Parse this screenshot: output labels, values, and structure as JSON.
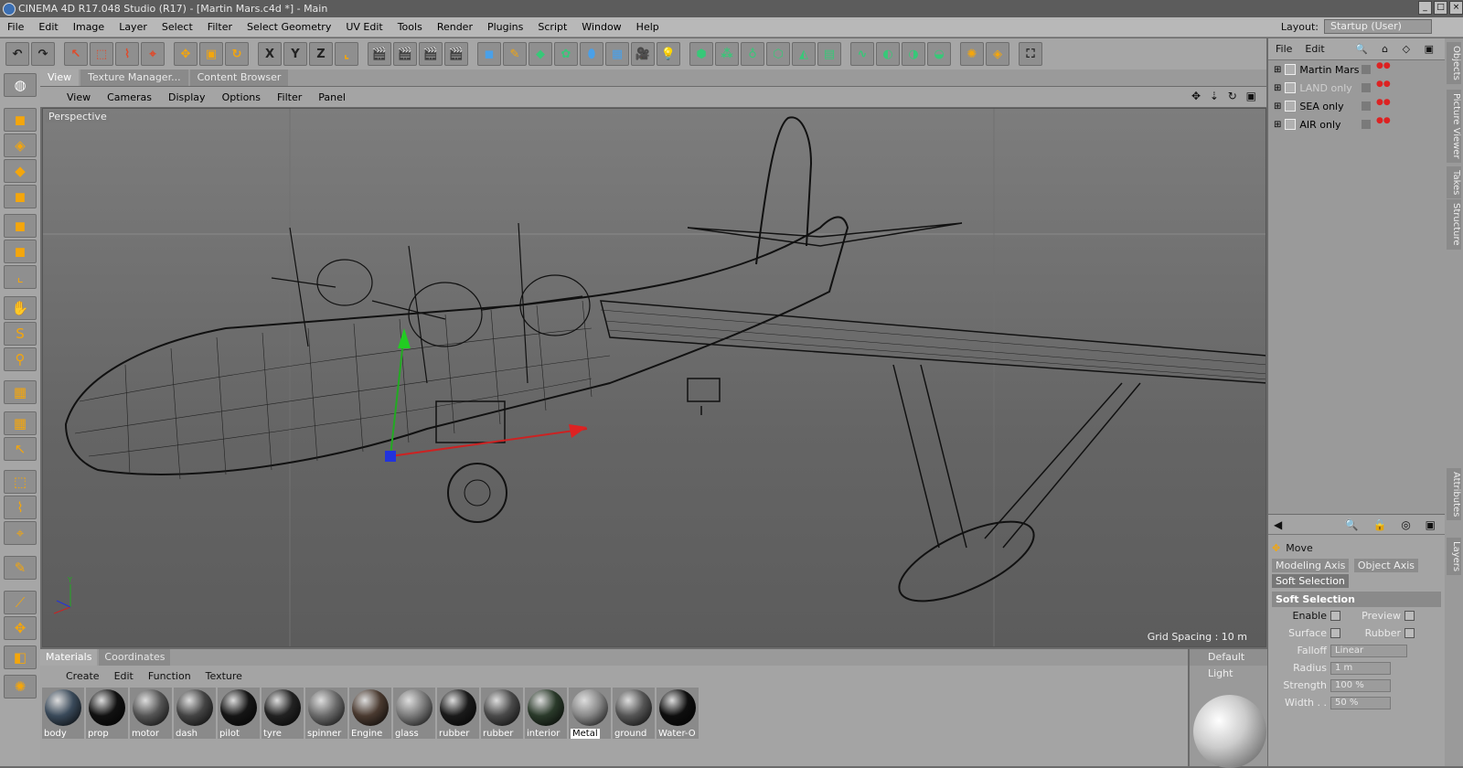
{
  "window": {
    "title": "CINEMA 4D R17.048 Studio (R17) - [Martin Mars.c4d *] - Main"
  },
  "menu": [
    "File",
    "Edit",
    "Image",
    "Layer",
    "Select",
    "Filter",
    "Select Geometry",
    "UV Edit",
    "Tools",
    "Render",
    "Plugins",
    "Script",
    "Window",
    "Help"
  ],
  "layout": {
    "label": "Layout:",
    "value": "Startup (User)"
  },
  "toolbar": [
    {
      "icon": "undo-icon",
      "glyph": "↶",
      "c": "k"
    },
    {
      "icon": "redo-icon",
      "glyph": "↷",
      "c": "k"
    },
    {
      "icon": "live-selection-icon",
      "glyph": "↖",
      "c": "r"
    },
    {
      "icon": "rectangle-selection-icon",
      "glyph": "⬚",
      "c": "r"
    },
    {
      "icon": "lasso-selection-icon",
      "glyph": "⌇",
      "c": "r"
    },
    {
      "icon": "polygon-selection-icon",
      "glyph": "⌖",
      "c": "r"
    },
    {
      "icon": "move-icon",
      "glyph": "✥",
      "c": "o"
    },
    {
      "icon": "scale-icon",
      "glyph": "▣",
      "c": "o"
    },
    {
      "icon": "rotate-icon",
      "glyph": "↻",
      "c": "o"
    },
    {
      "icon": "x-axis-icon",
      "glyph": "X",
      "c": "k"
    },
    {
      "icon": "y-axis-icon",
      "glyph": "Y",
      "c": "k"
    },
    {
      "icon": "z-axis-icon",
      "glyph": "Z",
      "c": "k"
    },
    {
      "icon": "coordinate-system-icon",
      "glyph": "⌞",
      "c": "o"
    },
    {
      "icon": "render-view-icon",
      "glyph": "🎬",
      "c": "k"
    },
    {
      "icon": "render-picture-viewer-icon",
      "glyph": "🎬",
      "c": "k"
    },
    {
      "icon": "render-settings-icon",
      "glyph": "🎬",
      "c": "k"
    },
    {
      "icon": "edit-render-settings-icon",
      "glyph": "🎬",
      "c": "k"
    },
    {
      "icon": "cube-icon",
      "glyph": "◼",
      "c": "b"
    },
    {
      "icon": "pen-icon",
      "glyph": "✎",
      "c": "o"
    },
    {
      "icon": "subdivision-icon",
      "glyph": "◆",
      "c": "g"
    },
    {
      "icon": "cloner-icon",
      "glyph": "✿",
      "c": "g"
    },
    {
      "icon": "deformer-icon",
      "glyph": "⬮",
      "c": "b"
    },
    {
      "icon": "floor-icon",
      "glyph": "▦",
      "c": "b"
    },
    {
      "icon": "camera-icon",
      "glyph": "🎥",
      "c": "k"
    },
    {
      "icon": "light-icon",
      "glyph": "💡",
      "c": "w"
    },
    {
      "icon": "polygon-object-icon",
      "glyph": "⬢",
      "c": "g"
    },
    {
      "icon": "points-mode-icon",
      "glyph": "⁂",
      "c": "g"
    },
    {
      "icon": "edges-mode-icon",
      "glyph": "♁",
      "c": "g"
    },
    {
      "icon": "polygons-mode-icon",
      "glyph": "⬡",
      "c": "g"
    },
    {
      "icon": "uv-mode-icon",
      "glyph": "◭",
      "c": "g"
    },
    {
      "icon": "texture-mode-icon",
      "glyph": "▤",
      "c": "g"
    },
    {
      "icon": "spline-icon",
      "glyph": "∿",
      "c": "g"
    },
    {
      "icon": "nurbs-icon",
      "glyph": "◐",
      "c": "g"
    },
    {
      "icon": "boole-icon",
      "glyph": "◑",
      "c": "g"
    },
    {
      "icon": "symmetry-icon",
      "glyph": "◒",
      "c": "g"
    },
    {
      "icon": "mograph-icon",
      "glyph": "✺",
      "c": "o"
    },
    {
      "icon": "texture-tag-icon",
      "glyph": "◈",
      "c": "o"
    },
    {
      "icon": "fullscreen-icon",
      "glyph": "⛶",
      "c": "k"
    }
  ],
  "lefttools": [
    "model-mode-icon",
    "object-mode-icon",
    "texture-axis-icon",
    "workplane-icon",
    "points-icon",
    "edges-icon",
    "polygons-icon",
    "axis-icon",
    "tweak-icon",
    "snap-icon",
    "magnet-icon",
    "locked-workplane-icon",
    "planar-workplane-icon",
    "live-select-icon",
    "rect-select-icon",
    "lasso-select-icon",
    "poly-select-icon",
    "brush-icon",
    "eyedropper-icon",
    "move-tool-icon",
    "paint-icon",
    "mograph-tool-icon"
  ],
  "viewport_tabs": [
    "View",
    "Texture Manager...",
    "Content Browser"
  ],
  "viewport_menu": [
    "View",
    "Cameras",
    "Display",
    "Options",
    "Filter",
    "Panel"
  ],
  "viewport": {
    "label": "Perspective",
    "grid": "Grid Spacing : 10 m"
  },
  "objects": {
    "menu": [
      "File",
      "Edit"
    ],
    "items": [
      {
        "name": "Martin Mars",
        "dim": false
      },
      {
        "name": "LAND only",
        "dim": true
      },
      {
        "name": "SEA only",
        "dim": false
      },
      {
        "name": "AIR only",
        "dim": false
      }
    ]
  },
  "right_tabs": [
    "Objects",
    "Picture Viewer",
    "Takes",
    "Structure",
    "Attributes",
    "Layers"
  ],
  "attributes": {
    "tool": "Move",
    "tabs": [
      "Modeling Axis",
      "Object Axis",
      "Soft Selection"
    ],
    "section": "Soft Selection",
    "enable": "Enable",
    "preview": "Preview",
    "surface": "Surface",
    "rubber": "Rubber",
    "falloff": "Falloff",
    "falloff_value": "Linear",
    "radius": "Radius",
    "radius_value": "1 m",
    "strength": "Strength",
    "strength_value": "100 %",
    "width": "Width . .",
    "width_value": "50 %"
  },
  "bottom": {
    "tabs": [
      "Materials",
      "Coordinates"
    ],
    "menu": [
      "Create",
      "Edit",
      "Function",
      "Texture"
    ],
    "materials": [
      {
        "name": "body",
        "c": "#3a4a5a"
      },
      {
        "name": "prop",
        "c": "#111"
      },
      {
        "name": "motor",
        "c": "#555"
      },
      {
        "name": "dash",
        "c": "#444"
      },
      {
        "name": "pilot",
        "c": "#151515"
      },
      {
        "name": "tyre",
        "c": "#222"
      },
      {
        "name": "spinner",
        "c": "#6a6a6a"
      },
      {
        "name": "Engine",
        "c": "#4a3a30"
      },
      {
        "name": "glass",
        "c": "#7a7a7a"
      },
      {
        "name": "rubber",
        "c": "#1a1a1a"
      },
      {
        "name": "rubber",
        "c": "#4a4a4a"
      },
      {
        "name": "interior",
        "c": "#2a3a2a"
      },
      {
        "name": "Metal",
        "c": "#888"
      },
      {
        "name": "ground",
        "c": "#555"
      },
      {
        "name": "Water-O",
        "c": "#0e0e0e"
      }
    ],
    "selected": "Metal"
  },
  "preview": {
    "label": "Default Light"
  }
}
